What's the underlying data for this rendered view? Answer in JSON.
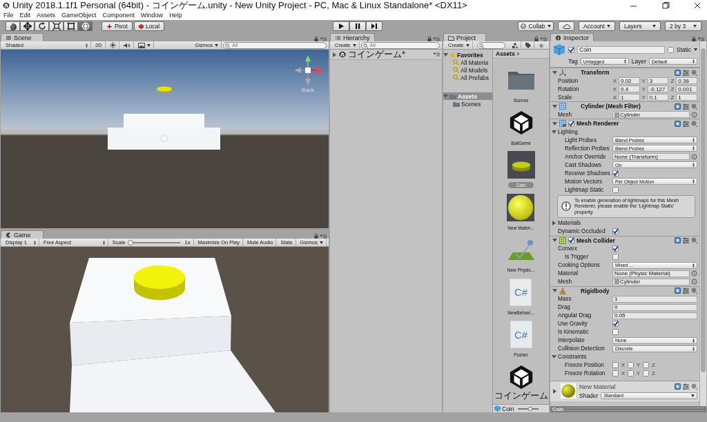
{
  "window": {
    "title": "Unity 2018.1.1f1 Personal (64bit) - コインゲーム.unity - New Unity Project - PC, Mac & Linux Standalone* <DX11>"
  },
  "menu": [
    "File",
    "Edit",
    "Assets",
    "GameObject",
    "Component",
    "Window",
    "Help"
  ],
  "toolbar": {
    "tools": [
      {
        "kind": "hand",
        "selected": false
      },
      {
        "kind": "move",
        "selected": false
      },
      {
        "kind": "rotate",
        "selected": false
      },
      {
        "kind": "scale",
        "selected": false
      },
      {
        "kind": "rect",
        "selected": false
      },
      {
        "kind": "transform",
        "selected": true
      }
    ],
    "pivot": "Pivot",
    "space": "Local",
    "collab": "Collab",
    "account": "Account",
    "layers": "Layers",
    "layout": "2 by 3"
  },
  "scene": {
    "tab": "Scene",
    "shading": "Shaded",
    "mode_2d": "2D",
    "gizmos": "Gizmos",
    "search_placeholder": "All",
    "view_label": "Back"
  },
  "game": {
    "tab": "Game",
    "display": "Display 1",
    "aspect": "Free Aspect",
    "scale_label": "Scale",
    "scale": {
      "level": 0
    },
    "scale_value": "1x",
    "buttons": [
      "Maximize On Play",
      "Mute Audio",
      "Stats",
      "Gizmos"
    ]
  },
  "hierarchy": {
    "tab": "Hierarchy",
    "create": "Create",
    "search_placeholder": "All",
    "rows": [
      {
        "label": "コインゲーム*",
        "expanded": false
      }
    ]
  },
  "project": {
    "tab": "Project",
    "create": "Create",
    "tree": [
      {
        "label": "Favorites",
        "kind": "favorites",
        "expanded": true,
        "selected": false,
        "children": [
          {
            "label": "All Materia",
            "kind": "search",
            "selected": false
          },
          {
            "label": "All Models",
            "kind": "search",
            "selected": false
          },
          {
            "label": "All Prefabs",
            "kind": "search",
            "selected": false
          }
        ]
      },
      {
        "label": "Assets",
        "kind": "folder",
        "expanded": true,
        "selected": true,
        "children": [
          {
            "label": "Scenes",
            "kind": "folder",
            "selected": false
          }
        ]
      }
    ],
    "breadcrumb": "Assets",
    "items": [
      {
        "label": "Scenes",
        "kind": "folder",
        "selected": false
      },
      {
        "label": "BallGame",
        "kind": "unity",
        "selected": false
      },
      {
        "label": "Coin",
        "kind": "mesh",
        "selected": true
      },
      {
        "label": "New Materi...",
        "kind": "material",
        "selected": false
      },
      {
        "label": "New Physic...",
        "kind": "physic",
        "selected": false
      },
      {
        "label": "NewBehavi...",
        "kind": "script",
        "badge": "C#",
        "selected": false
      },
      {
        "label": "Pusher",
        "kind": "script",
        "badge": "C#",
        "selected": false
      },
      {
        "label": "コインゲーム",
        "kind": "unity",
        "selected": false
      }
    ],
    "status": "Coin",
    "zoom": {
      "level": 0.6
    }
  },
  "inspector": {
    "tab": "Inspector",
    "active": true,
    "name": "Coin",
    "static": false,
    "static_label": "Static",
    "tag_label": "Tag",
    "tag": "Untagged",
    "layer_label": "Layer",
    "layer": "Default",
    "components": [
      {
        "kind": "transform",
        "title": "Transform",
        "expanded": true,
        "rows": [
          {
            "kind": "vector3",
            "label": "Position",
            "fields": [
              {
                "axis": "X",
                "value": "0.02"
              },
              {
                "axis": "Y",
                "value": "3"
              },
              {
                "axis": "Z",
                "value": "0.36"
              }
            ]
          },
          {
            "kind": "vector3",
            "label": "Rotation",
            "fields": [
              {
                "axis": "X",
                "value": "0.4"
              },
              {
                "axis": "Y",
                "value": "-0.127"
              },
              {
                "axis": "Z",
                "value": "0.001"
              }
            ]
          },
          {
            "kind": "vector3",
            "label": "Scale",
            "fields": [
              {
                "axis": "X",
                "value": "1"
              },
              {
                "axis": "Y",
                "value": "0.1"
              },
              {
                "axis": "Z",
                "value": "1"
              }
            ]
          }
        ]
      },
      {
        "kind": "mesh-filter",
        "title": "Cylinder (Mesh Filter)",
        "expanded": true,
        "rows": [
          {
            "kind": "mesh-object",
            "label": "Mesh",
            "value": "Cylinder"
          }
        ]
      },
      {
        "kind": "mesh-renderer",
        "title": "Mesh Renderer",
        "enabled": true,
        "expanded": true,
        "rows": [
          {
            "kind": "foldout",
            "label": "Lighting",
            "expanded": true,
            "children": [
              {
                "kind": "dropdown",
                "label": "Light Probes",
                "value": "Blend Probes"
              },
              {
                "kind": "dropdown",
                "label": "Reflection Probes",
                "value": "Blend Probes"
              },
              {
                "kind": "object",
                "label": "Anchor Override",
                "value": "None (Transform)"
              },
              {
                "kind": "dropdown",
                "label": "Cast Shadows",
                "value": "On"
              },
              {
                "kind": "checkbox",
                "label": "Receive Shadows",
                "checked": true
              },
              {
                "kind": "dropdown",
                "label": "Motion Vectors",
                "value": "Per Object Motion"
              },
              {
                "kind": "checkbox",
                "label": "Lightmap Static",
                "checked": false
              },
              {
                "kind": "help",
                "text": "To enable generation of lightmaps for this Mesh Renderer, please enable the 'Lightmap Static' property."
              }
            ]
          },
          {
            "kind": "foldout",
            "label": "Materials",
            "expanded": false
          },
          {
            "kind": "checkbox",
            "label": "Dynamic Occluded",
            "checked": true
          }
        ]
      },
      {
        "kind": "mesh-collider",
        "title": "Mesh Collider",
        "enabled": true,
        "expanded": true,
        "rows": [
          {
            "kind": "checkbox",
            "label": "Convex",
            "checked": true,
            "children": [
              {
                "kind": "checkbox",
                "label": "Is Trigger",
                "checked": false
              }
            ]
          },
          {
            "kind": "dropdown",
            "label": "Cooking Options",
            "value": "Mixed ..."
          },
          {
            "kind": "object",
            "label": "Material",
            "value": "None (Physic Material)"
          },
          {
            "kind": "mesh-object",
            "label": "Mesh",
            "value": "Cylinder"
          }
        ]
      },
      {
        "kind": "rigidbody",
        "title": "Rigidbody",
        "expanded": true,
        "rows": [
          {
            "kind": "text",
            "label": "Mass",
            "value": "1"
          },
          {
            "kind": "text",
            "label": "Drag",
            "value": "0"
          },
          {
            "kind": "text",
            "label": "Angular Drag",
            "value": "0.05"
          },
          {
            "kind": "checkbox",
            "label": "Use Gravity",
            "checked": true
          },
          {
            "kind": "checkbox",
            "label": "Is Kinematic",
            "checked": false
          },
          {
            "kind": "dropdown",
            "label": "Interpolate",
            "value": "None"
          },
          {
            "kind": "dropdown",
            "label": "Collision Detection",
            "value": "Discrete"
          },
          {
            "kind": "foldout",
            "label": "Constraints",
            "expanded": true,
            "children": [
              {
                "kind": "toggles3",
                "label": "Freeze Position",
                "toggles": [
                  {
                    "axis": "X",
                    "checked": false
                  },
                  {
                    "axis": "Y",
                    "checked": false
                  },
                  {
                    "axis": "Z",
                    "checked": false
                  }
                ]
              },
              {
                "kind": "toggles3",
                "label": "Freeze Rotation",
                "toggles": [
                  {
                    "axis": "X",
                    "checked": false
                  },
                  {
                    "axis": "Y",
                    "checked": false
                  },
                  {
                    "axis": "Z",
                    "checked": false
                  }
                ]
              }
            ]
          }
        ]
      }
    ],
    "material": {
      "name": "New Material",
      "shader_label": "Shader",
      "shader": "Standard",
      "expanded": false
    },
    "status": "Coin"
  }
}
